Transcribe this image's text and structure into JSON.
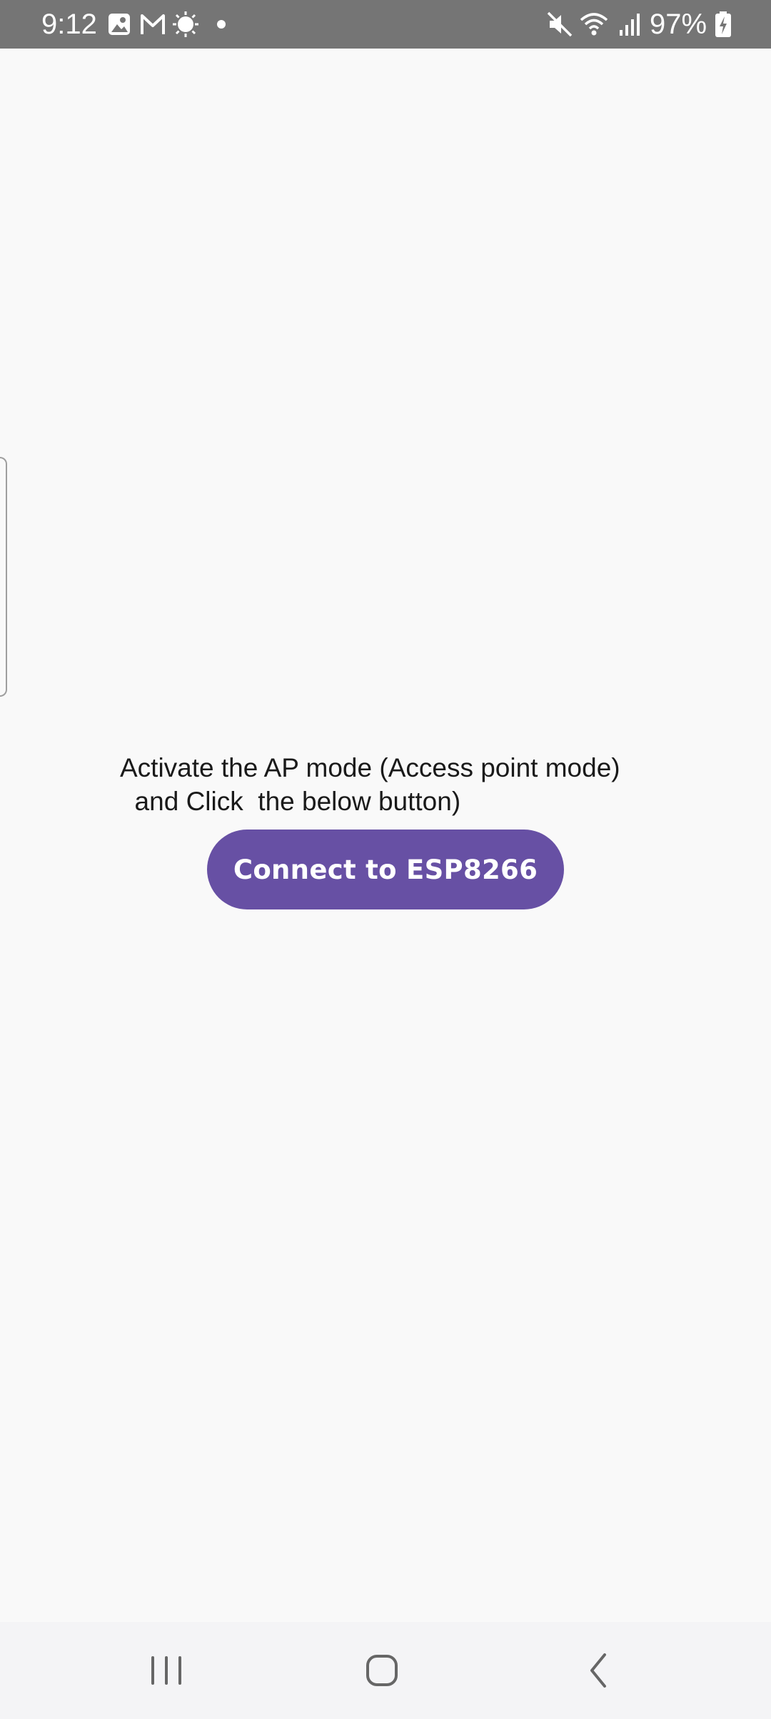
{
  "status_bar": {
    "time": "9:12",
    "battery_percent": "97%",
    "left_icons": [
      "gallery-icon",
      "gmail-icon",
      "weather-sun-icon",
      "notification-dot-icon"
    ],
    "right_icons": [
      "mute-icon",
      "wifi-icon",
      "signal-icon",
      "battery-charging-icon"
    ]
  },
  "main": {
    "instruction": "Activate the AP mode (Access point mode)\n  and Click  the below button)",
    "connect_button_label": "Connect to ESP8266"
  },
  "nav_bar": {
    "buttons": [
      "recent-apps-button",
      "home-button",
      "back-button"
    ]
  },
  "colors": {
    "accent": "#6750a4",
    "status_bar_bg": "#757575",
    "background": "#f9f9f9"
  }
}
